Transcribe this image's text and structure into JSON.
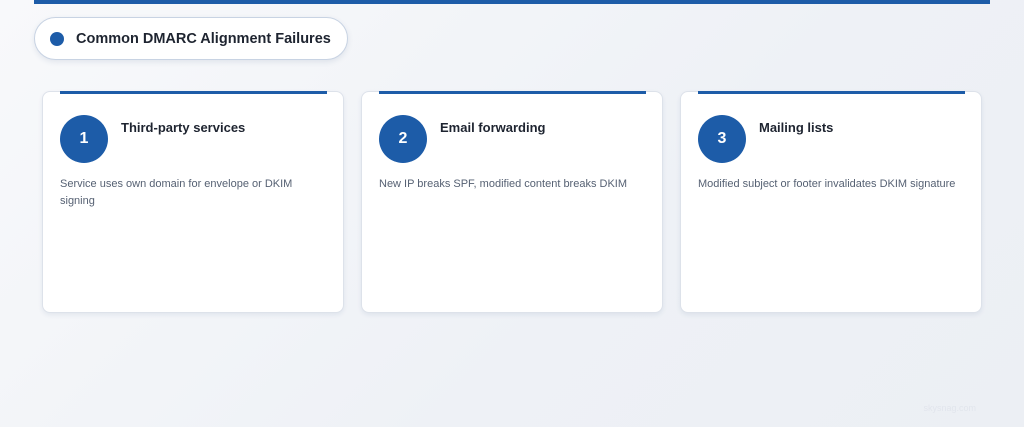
{
  "header": {
    "title": "Common DMARC Alignment Failures",
    "accent_color": "#1d5ca8"
  },
  "cards": [
    {
      "number": "1",
      "title": "Third-party services",
      "description": "Service uses own domain for envelope or DKIM signing"
    },
    {
      "number": "2",
      "title": "Email forwarding",
      "description": "New IP breaks SPF, modified content breaks DKIM"
    },
    {
      "number": "3",
      "title": "Mailing lists",
      "description": "Modified subject or footer invalidates DKIM signature"
    }
  ],
  "watermark": "skysnag.com"
}
